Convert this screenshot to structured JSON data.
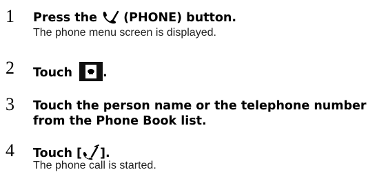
{
  "steps": [
    {
      "number": "1",
      "title_before": "Press the",
      "title_after": "(PHONE) button.",
      "icon": "phone-handset-icon",
      "description": "The phone menu screen is displayed."
    },
    {
      "number": "2",
      "title_before": "Touch",
      "title_after": ".",
      "icon": "phonebook-button-icon"
    },
    {
      "number": "3",
      "title_line1": "Touch the person name or the telephone number",
      "title_line2": "from the Phone Book list."
    },
    {
      "number": "4",
      "title_before": "Touch [",
      "title_after": "].",
      "icon": "call-start-icon",
      "description": "The phone call is started."
    }
  ]
}
